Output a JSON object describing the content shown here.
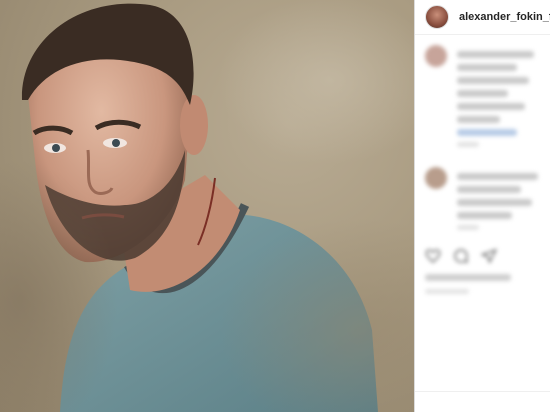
{
  "post": {
    "author": {
      "username": "alexander_fokin_fo",
      "separator": "•"
    }
  }
}
